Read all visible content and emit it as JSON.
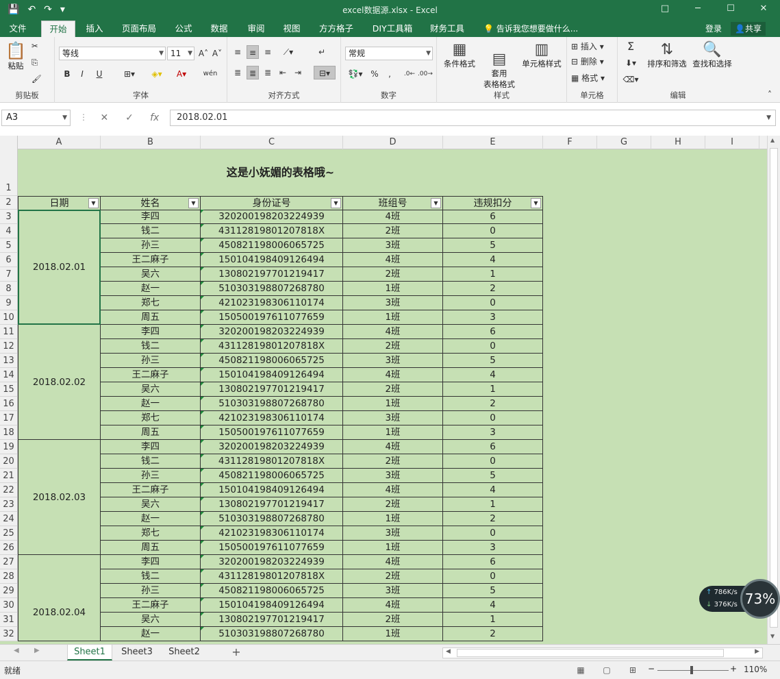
{
  "window": {
    "title": "excel数据源.xlsx - Excel",
    "controls": [
      "□",
      "─",
      "☐",
      "✕"
    ]
  },
  "qat": {
    "save": "💾",
    "undo": "↶",
    "redo": "↷",
    "more": "▾"
  },
  "tabs": [
    "文件",
    "开始",
    "插入",
    "页面布局",
    "公式",
    "数据",
    "审阅",
    "视图",
    "方方格子",
    "DIY工具箱",
    "财务工具"
  ],
  "tell_me": "告诉我您想要做什么...",
  "login": "登录",
  "share": "共享",
  "ribbon": {
    "clipboard": {
      "paste": "粘贴",
      "title": "剪贴板"
    },
    "font": {
      "name": "等线",
      "size": "11",
      "title": "字体",
      "bold": "B",
      "italic": "I",
      "underline": "U",
      "grow": "A˄",
      "shrink": "A˅",
      "wen": "wén"
    },
    "alignment": {
      "title": "对齐方式"
    },
    "number": {
      "format": "常规",
      "title": "数字",
      "percent": "%",
      "comma": ","
    },
    "styles": {
      "conditional": "条件格式",
      "table_format": "套用\n表格格式",
      "cell_style": "单元格样式",
      "title": "样式"
    },
    "cells": {
      "insert": "插入",
      "delete": "删除",
      "format": "格式",
      "title": "单元格"
    },
    "editing": {
      "sort": "排序和筛选",
      "find": "查找和选择",
      "title": "编辑",
      "sigma": "Σ"
    }
  },
  "formula_bar": {
    "name_box": "A3",
    "fx": "fx",
    "value": "2018.02.01"
  },
  "columns": [
    "A",
    "B",
    "C",
    "D",
    "E",
    "F",
    "G",
    "H",
    "I"
  ],
  "sheet": {
    "title": "这是小妩媚的表格哦~",
    "headers": [
      "日期",
      "姓名",
      "身份证号",
      "班组号",
      "违规扣分"
    ],
    "dates": [
      "2018.02.01",
      "2018.02.02",
      "2018.02.03",
      "2018.02.04"
    ],
    "rows": [
      [
        "李四",
        "320200198203224939",
        "4班",
        "6"
      ],
      [
        "钱二",
        "43112819801207818X",
        "2班",
        "0"
      ],
      [
        "孙三",
        "450821198006065725",
        "3班",
        "5"
      ],
      [
        "王二麻子",
        "150104198409126494",
        "4班",
        "4"
      ],
      [
        "吴六",
        "130802197701219417",
        "2班",
        "1"
      ],
      [
        "赵一",
        "510303198807268780",
        "1班",
        "2"
      ],
      [
        "郑七",
        "421023198306110174",
        "3班",
        "0"
      ],
      [
        "周五",
        "150500197611077659",
        "1班",
        "3"
      ],
      [
        "李四",
        "320200198203224939",
        "4班",
        "6"
      ],
      [
        "钱二",
        "43112819801207818X",
        "2班",
        "0"
      ],
      [
        "孙三",
        "450821198006065725",
        "3班",
        "5"
      ],
      [
        "王二麻子",
        "150104198409126494",
        "4班",
        "4"
      ],
      [
        "吴六",
        "130802197701219417",
        "2班",
        "1"
      ],
      [
        "赵一",
        "510303198807268780",
        "1班",
        "2"
      ],
      [
        "郑七",
        "421023198306110174",
        "3班",
        "0"
      ],
      [
        "周五",
        "150500197611077659",
        "1班",
        "3"
      ],
      [
        "李四",
        "320200198203224939",
        "4班",
        "6"
      ],
      [
        "钱二",
        "43112819801207818X",
        "2班",
        "0"
      ],
      [
        "孙三",
        "450821198006065725",
        "3班",
        "5"
      ],
      [
        "王二麻子",
        "150104198409126494",
        "4班",
        "4"
      ],
      [
        "吴六",
        "130802197701219417",
        "2班",
        "1"
      ],
      [
        "赵一",
        "510303198807268780",
        "1班",
        "2"
      ],
      [
        "郑七",
        "421023198306110174",
        "3班",
        "0"
      ],
      [
        "周五",
        "150500197611077659",
        "1班",
        "3"
      ],
      [
        "李四",
        "320200198203224939",
        "4班",
        "6"
      ],
      [
        "钱二",
        "43112819801207818X",
        "2班",
        "0"
      ],
      [
        "孙三",
        "450821198006065725",
        "3班",
        "5"
      ],
      [
        "王二麻子",
        "150104198409126494",
        "4班",
        "4"
      ],
      [
        "吴六",
        "130802197701219417",
        "2班",
        "1"
      ],
      [
        "赵一",
        "510303198807268780",
        "1班",
        "2"
      ]
    ]
  },
  "row_numbers": [
    "1",
    "2",
    "3",
    "4",
    "5",
    "6",
    "7",
    "8",
    "9",
    "10",
    "11",
    "12",
    "13",
    "14",
    "15",
    "16",
    "17",
    "18",
    "19",
    "20",
    "21",
    "22",
    "23",
    "24",
    "25",
    "26",
    "27",
    "28",
    "29",
    "30",
    "31",
    "32"
  ],
  "sheet_tabs": [
    "Sheet1",
    "Sheet3",
    "Sheet2"
  ],
  "add_sheet": "+",
  "network": {
    "up": "786K/s",
    "down": "376K/s",
    "percent": "73%"
  },
  "status": {
    "ready": "就绪",
    "zoom": "110%"
  },
  "colors": {
    "brand": "#217346",
    "grid_fill": "#c6e0b4"
  }
}
